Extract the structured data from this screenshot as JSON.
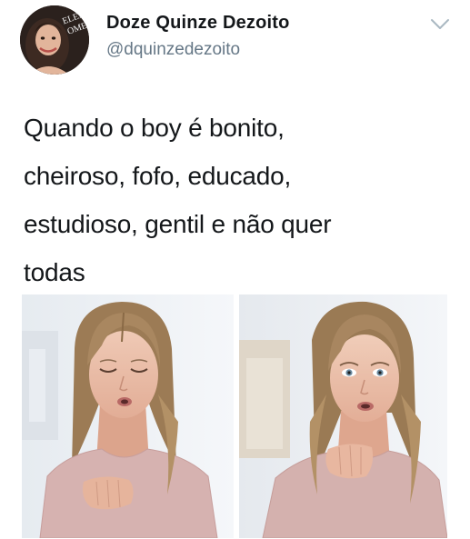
{
  "tweet": {
    "display_name": "Doze Quinze Dezoito",
    "handle": "@dquinzedezoito",
    "text": "Quando o boy é bonito,\ncheiroso, fofo, educado,\nestudioso, gentil e não quer\ntodas"
  },
  "avatar": {
    "overlay_text_line1": "ELEN",
    "overlay_text_line2": "OME"
  },
  "icons": {
    "menu": "chevron-down-icon"
  },
  "photos": [
    {
      "name": "photo-woman-eyes-closed"
    },
    {
      "name": "photo-woman-eyes-open"
    }
  ],
  "colors": {
    "text": "#14171a",
    "handle": "#657786",
    "sweater": "#d6b2b0",
    "hair": "#a68560",
    "background": "#ffffff"
  }
}
